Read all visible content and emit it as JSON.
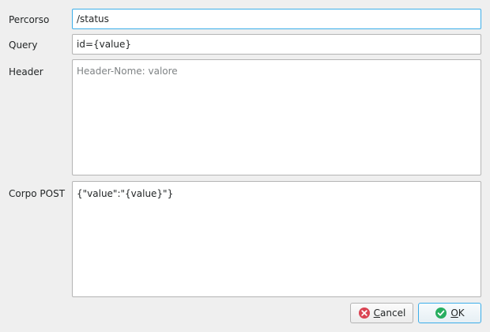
{
  "form": {
    "path": {
      "label": "Percorso",
      "value": "/status"
    },
    "query": {
      "label": "Query",
      "value": "id={value}"
    },
    "header": {
      "label": "Header",
      "placeholder": "Header-Nome: valore"
    },
    "post_body": {
      "label": "Corpo POST",
      "value": "{\"value\":\"{value}\"}"
    }
  },
  "buttons": {
    "cancel": {
      "mnemonic": "C",
      "rest": "ancel",
      "icon": "cancel-circle-icon",
      "icon_color": "#da4453"
    },
    "ok": {
      "mnemonic": "O",
      "rest": "K",
      "icon": "check-circle-icon",
      "icon_color": "#27ae60"
    }
  },
  "colors": {
    "focus_accent": "#3daee9",
    "window_bg": "#efefef"
  }
}
